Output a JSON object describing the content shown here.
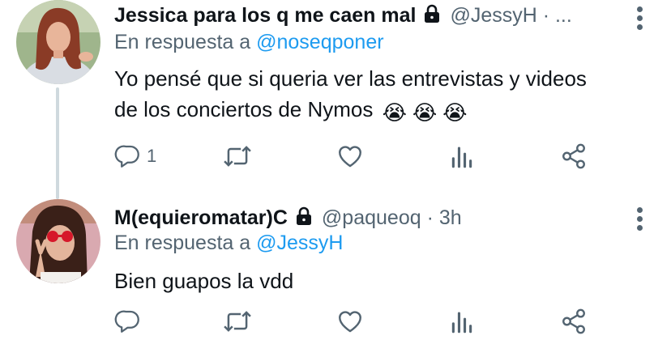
{
  "tweets": [
    {
      "display_name": "Jessica para los q me caen mal",
      "handle_meta": "@JessyH · ...",
      "reply_prefix": "En respuesta a",
      "reply_mention": "@noseqponer",
      "text_line1": "Yo pensé que si queria ver las entrevistas y videos",
      "text_line2": "de los conciertos de Nymos",
      "emojis": [
        "😭",
        "😭",
        "😭"
      ],
      "reply_count": "1",
      "avatar_icon": "profile-photo"
    },
    {
      "display_name": "M(equieromatar)C",
      "handle_meta": "@paqueoq · 3h",
      "reply_prefix": "En respuesta a",
      "reply_mention": "@JessyH",
      "text_line1": "Bien guapos la vdd",
      "reply_count": "",
      "avatar_icon": "profile-photo"
    }
  ],
  "colors": {
    "text": "#0f1419",
    "secondary": "#536471",
    "link": "#1d9bf0",
    "thread_line": "#cfd9de"
  }
}
